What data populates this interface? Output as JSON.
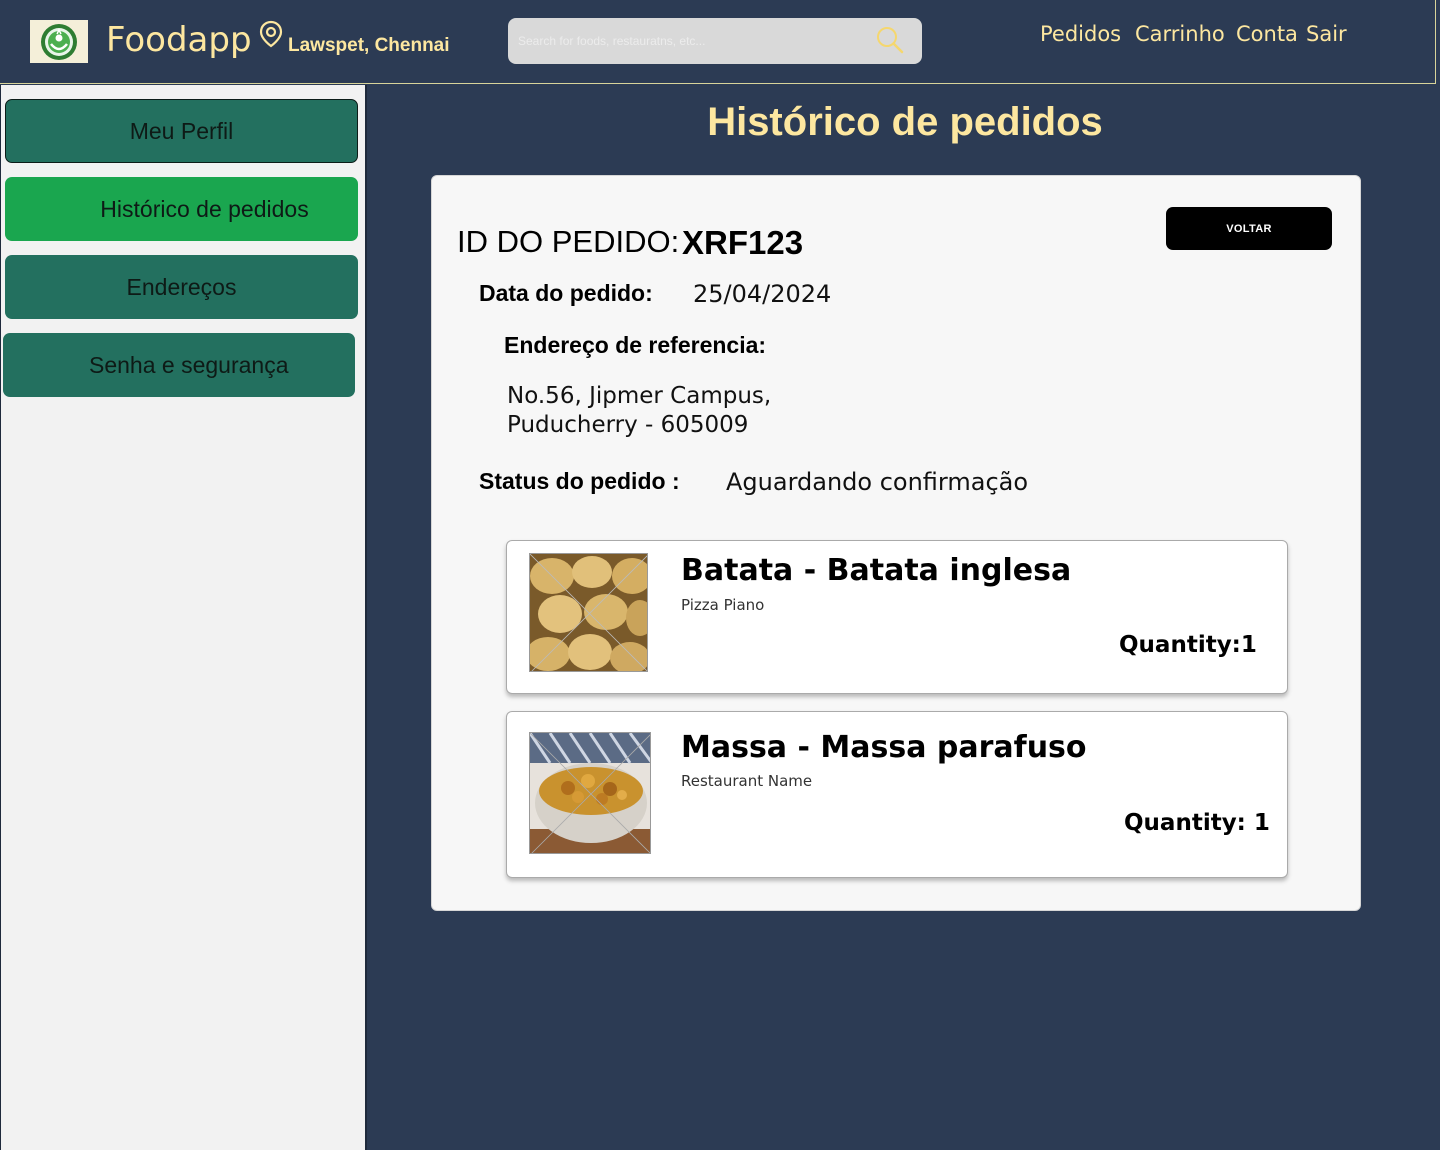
{
  "header": {
    "brand": "Foodapp",
    "location": "Lawspet, Chennai",
    "search_placeholder": "Search for foods, restauratns, etc...",
    "nav": {
      "orders": "Pedidos",
      "cart": "Carrinho",
      "account": "Conta",
      "logout": "Sair"
    }
  },
  "sidebar": {
    "items": [
      {
        "label": "Meu Perfil"
      },
      {
        "label": "Histórico de pedidos",
        "active": true
      },
      {
        "label": "Endereços"
      },
      {
        "label": "Senha e segurança"
      }
    ]
  },
  "main": {
    "title": "Histórico de pedidos",
    "order": {
      "id_label": "ID DO PEDIDO:",
      "id_value": "XRF123",
      "back_label": "VOLTAR",
      "date_label": "Data do pedido:",
      "date_value": "25/04/2024",
      "address_label": "Endereço de referencia:",
      "address_line1": "No.56, Jipmer Campus,",
      "address_line2": "Puducherry - 605009",
      "status_label": "Status do pedido :",
      "status_value": "Aguardando confirmação"
    },
    "items": [
      {
        "name": "Batata - Batata inglesa",
        "restaurant": "Pizza Piano",
        "quantity": "Quantity:1",
        "image": "potatoes"
      },
      {
        "name": "Massa - Massa parafuso",
        "restaurant": "Restaurant Name",
        "quantity": "Quantity: 1",
        "image": "fusilli-pasta"
      }
    ]
  },
  "colors": {
    "background": "#2c3b54",
    "accent_text": "#fde7a0",
    "sidebar_button": "#23705f",
    "sidebar_active": "#1aa64f"
  }
}
